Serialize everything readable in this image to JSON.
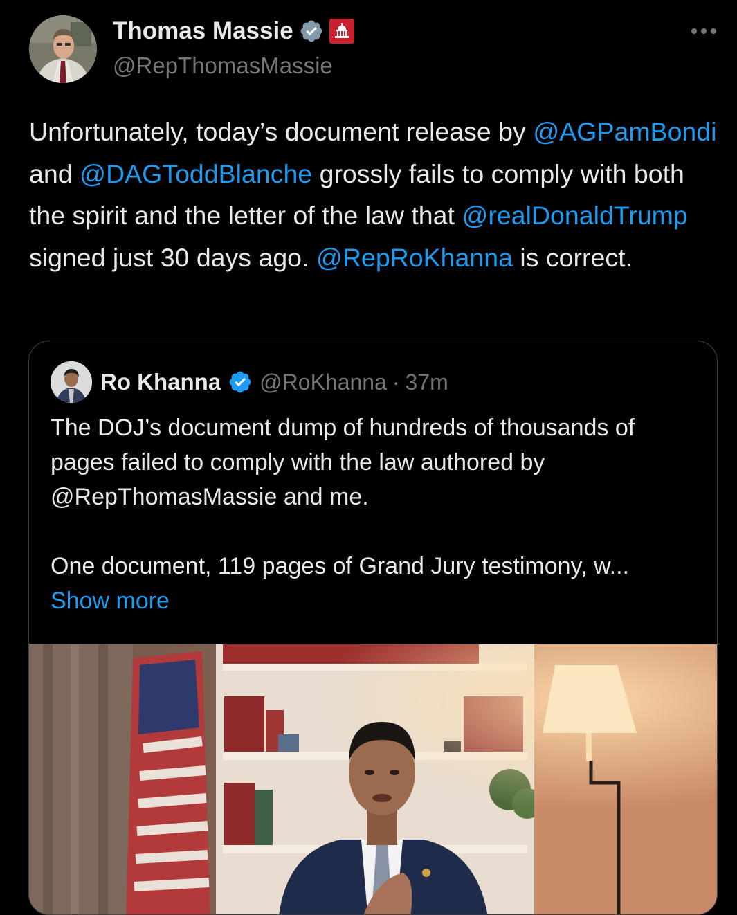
{
  "author": {
    "display_name": "Thomas Massie",
    "handle": "@RepThomasMassie",
    "verified_icon": "verified-badge-icon",
    "affiliation_icon": "us-capitol-badge-icon"
  },
  "tweet": {
    "t1": "Unfortunately, today’s document release by ",
    "m1": "@AGPamBondi",
    "t2": " and ",
    "m2": "@DAGToddBlanche",
    "t3": " grossly fails to comply with both the spirit and the letter of the law that ",
    "m3": "@realDonaldTrump",
    "t4": " signed just 30 days ago. ",
    "m4": "@RepRoKhanna",
    "t5": " is correct."
  },
  "quote": {
    "display_name": "Ro Khanna",
    "handle": "@RoKhanna",
    "separator": "·",
    "time": "37m",
    "paragraph1": "The DOJ’s document dump of hundreds of thousands of pages failed to comply with the law authored by @RepThomasMassie and me.",
    "paragraph2": "One document, 119 pages of Grand Jury testimony, w...",
    "show_more": "Show more"
  },
  "colors": {
    "background": "#000000",
    "text": "#e7e9ea",
    "secondary": "#71767b",
    "link": "#1d9bf0",
    "border": "#3e4144",
    "gov_badge": "#c7202e"
  }
}
